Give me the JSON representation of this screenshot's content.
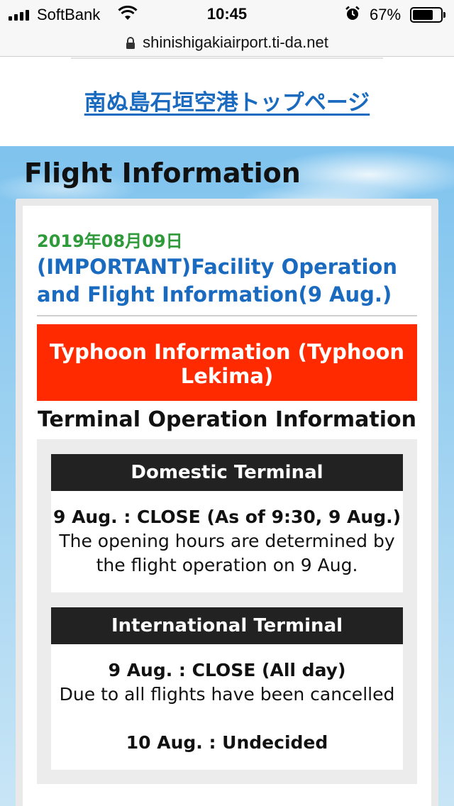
{
  "status_bar": {
    "carrier": "SoftBank",
    "time": "10:45",
    "battery_percent": "67%",
    "battery_level": 0.67
  },
  "browser": {
    "url": "shinishigakiairport.ti-da.net"
  },
  "header": {
    "top_link": "南ぬ島石垣空港トップページ"
  },
  "section": {
    "title": "Flight Information"
  },
  "post": {
    "date": "2019年08月09日",
    "title": "(IMPORTANT)Facility Operation and Flight Information(9 Aug.)",
    "banner": "Typhoon Information (Typhoon Lekima)",
    "terminal_heading": "Terminal Operation Information",
    "terminals": [
      {
        "name": "Domestic Terminal",
        "status": "9 Aug. : CLOSE (As of 9:30, 9 Aug.)",
        "note": "The opening hours are determined by the flight operation on 9 Aug."
      },
      {
        "name": "International Terminal",
        "status": "9 Aug. : CLOSE (All day)",
        "note": "Due to all flights have been cancelled",
        "next_status": "10 Aug. : Undecided"
      }
    ]
  },
  "colors": {
    "link_blue": "#1a6bbf",
    "date_green": "#2e9a3a",
    "banner_red": "#ff2a00",
    "terminal_header": "#222222"
  }
}
